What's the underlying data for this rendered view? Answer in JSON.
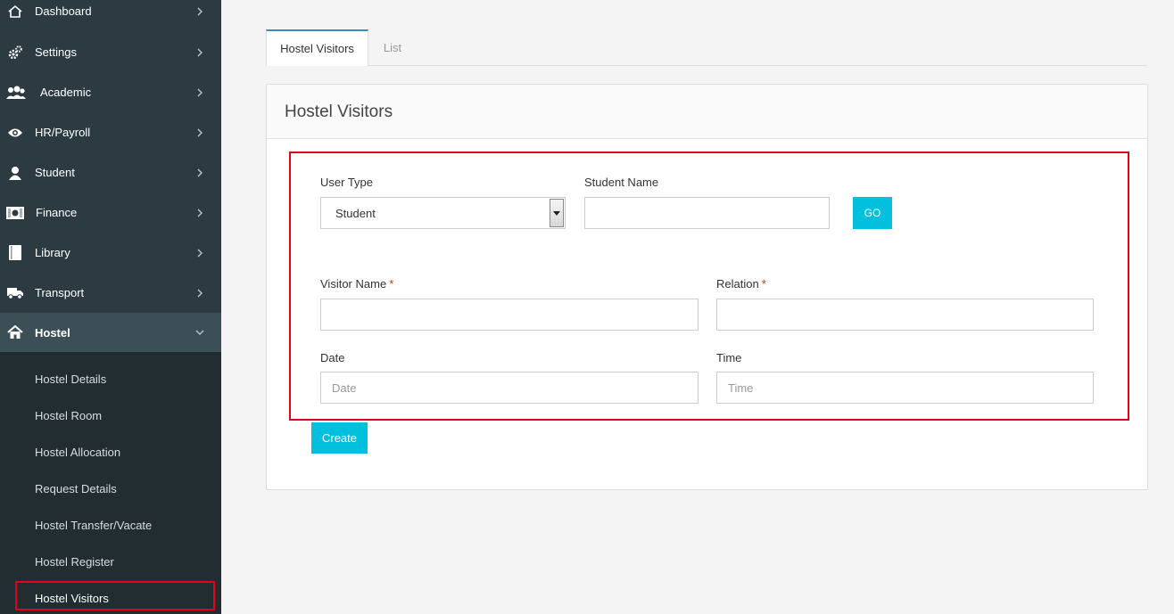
{
  "sidebar": {
    "items": [
      {
        "label": "Dashboard",
        "icon": "home-icon"
      },
      {
        "label": "Settings",
        "icon": "gears-icon"
      },
      {
        "label": "Academic",
        "icon": "users-icon"
      },
      {
        "label": "HR/Payroll",
        "icon": "eye-icon"
      },
      {
        "label": "Student",
        "icon": "user-icon"
      },
      {
        "label": "Finance",
        "icon": "money-icon"
      },
      {
        "label": "Library",
        "icon": "book-icon"
      },
      {
        "label": "Transport",
        "icon": "truck-icon"
      },
      {
        "label": "Hostel",
        "icon": "home-icon"
      }
    ],
    "hostel_submenu": [
      "Hostel Details",
      "Hostel Room",
      "Hostel Allocation",
      "Request Details",
      "Hostel Transfer/Vacate",
      "Hostel Register",
      "Hostel Visitors"
    ]
  },
  "tabs": {
    "active": "Hostel Visitors",
    "list": "List"
  },
  "panel": {
    "title": "Hostel Visitors"
  },
  "form": {
    "user_type_label": "User Type",
    "user_type_value": "Student",
    "student_name_label": "Student Name",
    "go_label": "GO",
    "visitor_name_label": "Visitor Name",
    "relation_label": "Relation",
    "required_mark": "*",
    "date_label": "Date",
    "date_placeholder": "Date",
    "time_label": "Time",
    "time_placeholder": "Time",
    "create_label": "Create"
  },
  "colors": {
    "sidebar_bg": "#2c3b41",
    "submenu_bg": "#222d32",
    "accent": "#00c0de",
    "highlight": "#e3001b"
  }
}
